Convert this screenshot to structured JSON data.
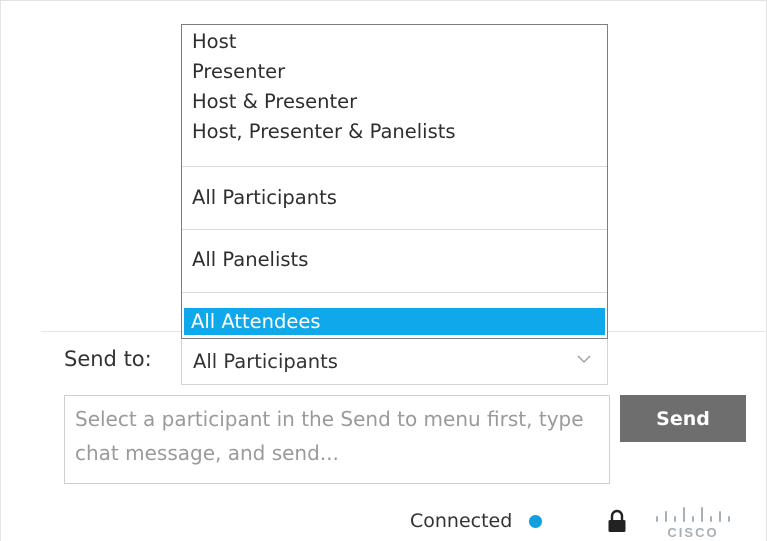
{
  "dropdown": {
    "options": [
      "Host",
      "Presenter",
      "Host & Presenter",
      "Host, Presenter & Panelists",
      "All Participants",
      "All Panelists",
      "All Attendees"
    ],
    "selected": "All Attendees",
    "selected_color": "#0fa8ea"
  },
  "send_to": {
    "label": "Send to:",
    "value": "All Participants",
    "chevron_icon": "chevron-down-icon"
  },
  "message": {
    "placeholder": "Select a participant in the Send to menu first, type chat message, and send...",
    "value": ""
  },
  "send_button": {
    "label": "Send",
    "color": "#6e6e6e"
  },
  "status": {
    "text": "Connected",
    "dot_color": "#129fdd",
    "lock_icon": "lock-icon",
    "logo": "cisco-logo"
  }
}
